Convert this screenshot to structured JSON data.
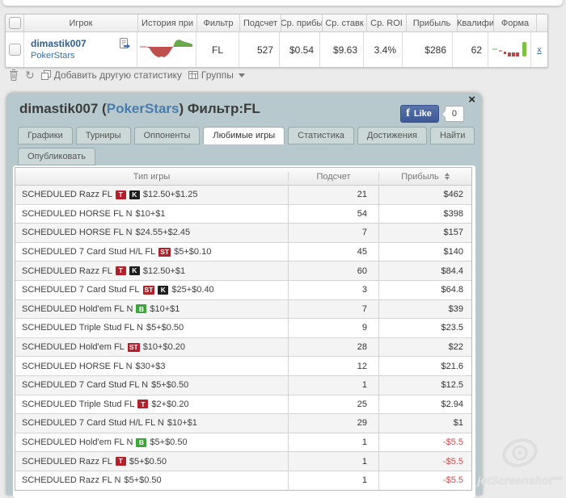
{
  "top_table": {
    "headers": [
      "Игрок",
      "История при",
      "Фильтр",
      "Подсчет",
      "Ср. прибы",
      "Ср. ставк",
      "Ср. ROI",
      "Прибыль",
      "Квалифи",
      "Форма"
    ],
    "row": {
      "player": "dimastik007",
      "site": "PokerStars",
      "filter": "FL",
      "count": "527",
      "avg_profit": "$0.54",
      "avg_stake": "$9.63",
      "avg_roi": "3.4%",
      "profit": "$286",
      "qualified": "62",
      "remove_label": "x"
    }
  },
  "toolbar": {
    "add_label": "Добавить другую статистику",
    "groups_label": "Группы",
    "refresh_glyph": "↻"
  },
  "panel": {
    "title": {
      "player": "dimastik007 (",
      "site": "PokerStars",
      "rest": ") Фильтр:FL"
    },
    "facebook": {
      "like_label": "Like",
      "count": "0"
    },
    "close_label": "×",
    "tabs": [
      {
        "label": "Графики",
        "active": false
      },
      {
        "label": "Турниры",
        "active": false
      },
      {
        "label": "Оппоненты",
        "active": false
      },
      {
        "label": "Любимые игры",
        "active": true
      },
      {
        "label": "Статистика",
        "active": false
      },
      {
        "label": "Достижения",
        "active": false
      },
      {
        "label": "Найти",
        "active": false
      },
      {
        "label": "Опубликовать",
        "active": false
      }
    ],
    "table": {
      "headers": [
        "Тип игры",
        "Подсчет",
        "Прибыль"
      ],
      "badge_colors": {
        "red": "#b3212a",
        "black": "#1e1e1e",
        "green": "#3da639"
      },
      "rows": [
        {
          "game": "SCHEDULED Razz FL",
          "badges": [
            {
              "t": "T",
              "c": "red"
            },
            {
              "t": "K",
              "c": "black"
            }
          ],
          "stake": "$12.50+$1.25",
          "count": "21",
          "profit": "$462",
          "neg": false
        },
        {
          "game": "SCHEDULED HORSE FL N",
          "badges": [],
          "stake": "$10+$1",
          "count": "54",
          "profit": "$398",
          "neg": false
        },
        {
          "game": "SCHEDULED HORSE FL N",
          "badges": [],
          "stake": "$24.55+$2.45",
          "count": "7",
          "profit": "$157",
          "neg": false
        },
        {
          "game": "SCHEDULED 7 Card Stud H/L FL",
          "badges": [
            {
              "t": "ST",
              "c": "red"
            }
          ],
          "stake": "$5+$0.10",
          "count": "45",
          "profit": "$140",
          "neg": false
        },
        {
          "game": "SCHEDULED Razz FL",
          "badges": [
            {
              "t": "T",
              "c": "red"
            },
            {
              "t": "K",
              "c": "black"
            }
          ],
          "stake": "$12.50+$1",
          "count": "60",
          "profit": "$84.4",
          "neg": false
        },
        {
          "game": "SCHEDULED 7 Card Stud FL",
          "badges": [
            {
              "t": "ST",
              "c": "red"
            },
            {
              "t": "K",
              "c": "black"
            }
          ],
          "stake": "$25+$0.40",
          "count": "3",
          "profit": "$64.8",
          "neg": false
        },
        {
          "game": "SCHEDULED Hold'em FL N",
          "badges": [
            {
              "t": "B",
              "c": "green"
            }
          ],
          "stake": "$10+$1",
          "count": "7",
          "profit": "$39",
          "neg": false
        },
        {
          "game": "SCHEDULED Triple Stud FL N",
          "badges": [],
          "stake": "$5+$0.50",
          "count": "9",
          "profit": "$23.5",
          "neg": false
        },
        {
          "game": "SCHEDULED Hold'em FL",
          "badges": [
            {
              "t": "ST",
              "c": "red"
            }
          ],
          "stake": "$10+$0.20",
          "count": "28",
          "profit": "$22",
          "neg": false
        },
        {
          "game": "SCHEDULED HORSE FL N",
          "badges": [],
          "stake": "$30+$3",
          "count": "12",
          "profit": "$21.6",
          "neg": false
        },
        {
          "game": "SCHEDULED 7 Card Stud FL N",
          "badges": [],
          "stake": "$5+$0.50",
          "count": "1",
          "profit": "$12.5",
          "neg": false
        },
        {
          "game": "SCHEDULED Triple Stud FL",
          "badges": [
            {
              "t": "T",
              "c": "red"
            }
          ],
          "stake": "$2+$0.20",
          "count": "25",
          "profit": "$2.94",
          "neg": false
        },
        {
          "game": "SCHEDULED 7 Card Stud H/L FL N",
          "badges": [],
          "stake": "$10+$1",
          "count": "29",
          "profit": "$1",
          "neg": false
        },
        {
          "game": "SCHEDULED Hold'em FL N",
          "badges": [
            {
              "t": "B",
              "c": "green"
            }
          ],
          "stake": "$5+$0.50",
          "count": "1",
          "profit": "-$5.5",
          "neg": true
        },
        {
          "game": "SCHEDULED Razz FL",
          "badges": [
            {
              "t": "T",
              "c": "red"
            }
          ],
          "stake": "$5+$0.50",
          "count": "1",
          "profit": "-$5.5",
          "neg": true
        },
        {
          "game": "SCHEDULED Razz FL N",
          "badges": [],
          "stake": "$5+$0.50",
          "count": "1",
          "profit": "-$5.5",
          "neg": true
        }
      ]
    }
  },
  "watermark": {
    "text": "jetScreenshot",
    "sup": "com"
  },
  "colors": {
    "accent_blue": "#3a70a8",
    "negative": "#c9504e",
    "panel_bg": "#b7c9cc",
    "fb_blue": "#3b5998"
  }
}
